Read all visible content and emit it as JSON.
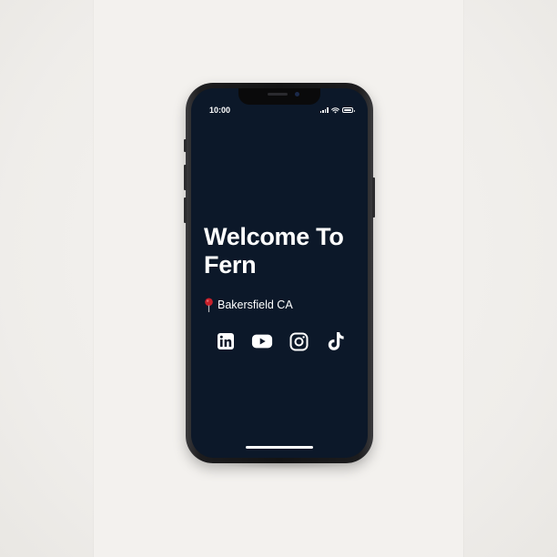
{
  "status_bar": {
    "time": "10:00"
  },
  "main": {
    "title": "Welcome To Fern",
    "location_icon": "map-pin-icon",
    "location_text": "Bakersfield CA"
  },
  "socials": [
    {
      "icon": "linkedin-icon"
    },
    {
      "icon": "youtube-icon"
    },
    {
      "icon": "instagram-icon"
    },
    {
      "icon": "tiktok-icon"
    }
  ],
  "colors": {
    "screen_background": "#0c1829",
    "text": "#ffffff",
    "pin": "#c8202a",
    "backdrop": "#f3f1ee"
  }
}
